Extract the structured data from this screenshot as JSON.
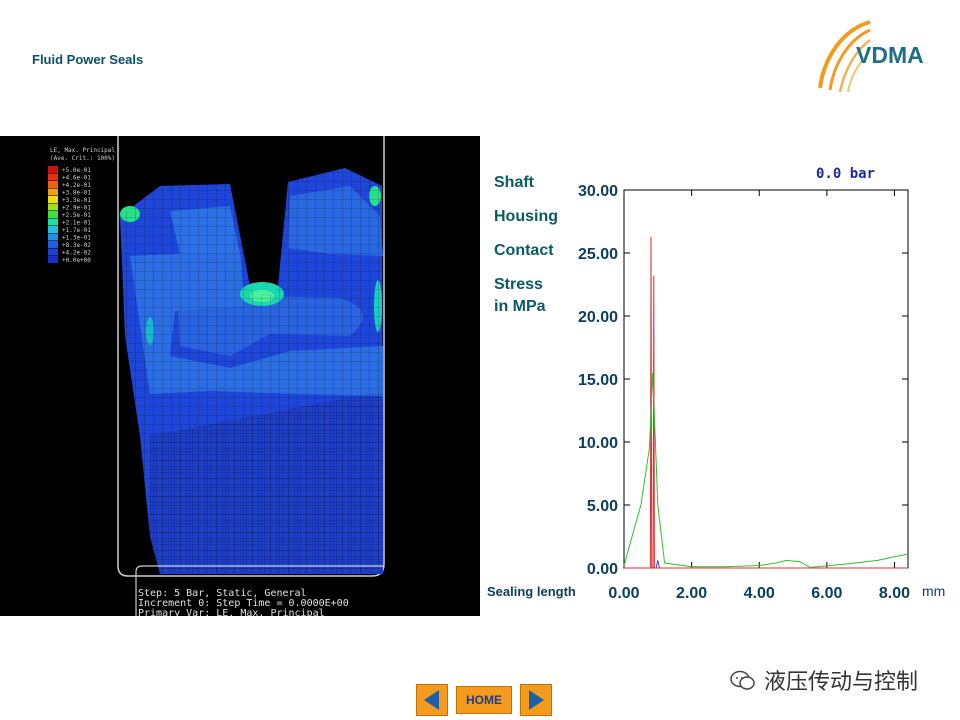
{
  "header": {
    "title": "Fluid Power Seals"
  },
  "logo": {
    "text": "VDMA"
  },
  "fem": {
    "legend_title": "LE, Max. Principal",
    "legend_subtitle": "(Ave. Crit.: 100%)",
    "legend_values": [
      "+5.0e-01",
      "+4.6e-01",
      "+4.2e-01",
      "+3.8e-01",
      "+3.3e-01",
      "+2.9e-01",
      "+2.5e-01",
      "+2.1e-01",
      "+1.7e-01",
      "+1.3e-01",
      "+8.3e-02",
      "+4.2e-02",
      "+0.0e+00"
    ],
    "legend_colors": [
      "#d01010",
      "#e83010",
      "#f06010",
      "#f0a010",
      "#e8e010",
      "#a0e020",
      "#40e040",
      "#20e0a0",
      "#20c0e0",
      "#2090e0",
      "#2060e0",
      "#2040d0",
      "#1830c0"
    ],
    "status_lines": [
      "Step: 5 Bar, Static, General",
      "Increment      0: Step Time =    0.0000E+00",
      "Primary Var: LE, Max. Principal"
    ]
  },
  "stress_labels": {
    "shaft": "Shaft",
    "housing": "Housing",
    "contact": "Contact",
    "stress_line1": "Stress",
    "stress_line2": "in MPa"
  },
  "sealing_label": "Sealing length",
  "chart_data": {
    "type": "line",
    "title": "0.0 bar",
    "xlabel": "mm",
    "ylabel": "",
    "xlim": [
      0,
      8.4
    ],
    "ylim": [
      0,
      30
    ],
    "x_ticks": [
      "0.00",
      "2.00",
      "4.00",
      "6.00",
      "8.00"
    ],
    "y_ticks": [
      "0.00",
      "5.00",
      "10.00",
      "15.00",
      "20.00",
      "25.00",
      "30.00"
    ],
    "series": [
      {
        "color": "#e03030",
        "points": [
          [
            0.0,
            0.0
          ],
          [
            0.78,
            0.0
          ],
          [
            0.8,
            26.3
          ],
          [
            0.82,
            0.0
          ],
          [
            0.86,
            0.0
          ],
          [
            0.88,
            23.2
          ],
          [
            0.9,
            0.0
          ],
          [
            8.4,
            0.0
          ]
        ]
      },
      {
        "color": "#30c030",
        "points": [
          [
            0.0,
            0.2
          ],
          [
            0.5,
            5.0
          ],
          [
            0.75,
            9.5
          ],
          [
            0.85,
            15.5
          ],
          [
            0.9,
            12.0
          ],
          [
            1.0,
            5.0
          ],
          [
            1.2,
            0.4
          ],
          [
            2.0,
            0.1
          ],
          [
            3.0,
            0.1
          ],
          [
            4.0,
            0.2
          ],
          [
            4.5,
            0.4
          ],
          [
            4.8,
            0.6
          ],
          [
            5.2,
            0.5
          ],
          [
            5.5,
            0.05
          ],
          [
            6.5,
            0.3
          ],
          [
            7.5,
            0.6
          ],
          [
            8.0,
            0.9
          ],
          [
            8.4,
            1.1
          ]
        ]
      },
      {
        "color": "#4040c0",
        "points": [
          [
            0.95,
            0.0
          ],
          [
            1.0,
            0.6
          ],
          [
            1.05,
            0.0
          ]
        ]
      }
    ]
  },
  "navigation": {
    "prev_icon": "arrow-left-icon",
    "home_label": "HOME",
    "next_icon": "arrow-right-icon"
  },
  "watermark": {
    "text": "液压传动与控制"
  }
}
